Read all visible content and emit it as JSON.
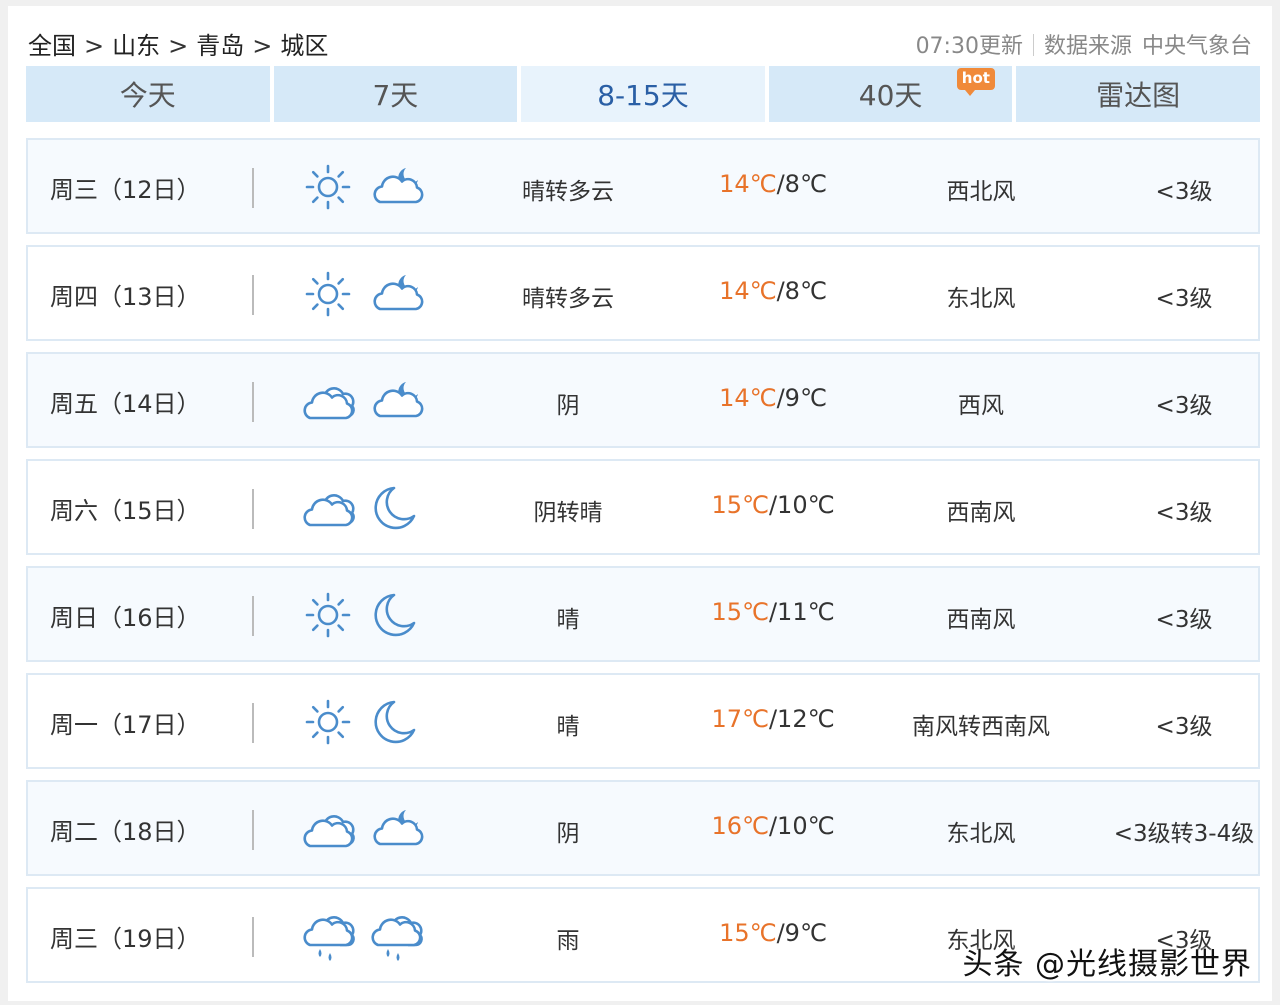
{
  "breadcrumb": [
    "全国",
    "山东",
    "青岛",
    "城区"
  ],
  "breadcrumb_separator": ">",
  "update": {
    "time_text": "07:30更新",
    "source_label": "数据来源",
    "source_name": "中央气象台"
  },
  "tabs": [
    {
      "label": "今天",
      "active": false
    },
    {
      "label": "7天",
      "active": false
    },
    {
      "label": "8-15天",
      "active": true
    },
    {
      "label": "40天",
      "active": false,
      "badge": "hot"
    },
    {
      "label": "雷达图",
      "active": false
    }
  ],
  "colors": {
    "accent": "#2a5fa5",
    "tab_bg": "#d6e9f8",
    "high_temp": "#e8732a",
    "icon": "#4a8ccb",
    "badge": "#f08a3a"
  },
  "forecast": [
    {
      "date": "周三（12日）",
      "day_icon": "sun-icon",
      "night_icon": "cloud-moon-icon",
      "condition": "晴转多云",
      "high": "14℃",
      "low": "8℃",
      "wind": "西北风",
      "level": "<3级"
    },
    {
      "date": "周四（13日）",
      "day_icon": "sun-icon",
      "night_icon": "cloud-moon-icon",
      "condition": "晴转多云",
      "high": "14℃",
      "low": "8℃",
      "wind": "东北风",
      "level": "<3级"
    },
    {
      "date": "周五（14日）",
      "day_icon": "overcast-icon",
      "night_icon": "cloud-moon-icon",
      "condition": "阴",
      "high": "14℃",
      "low": "9℃",
      "wind": "西风",
      "level": "<3级"
    },
    {
      "date": "周六（15日）",
      "day_icon": "overcast-icon",
      "night_icon": "moon-icon",
      "condition": "阴转晴",
      "high": "15℃",
      "low": "10℃",
      "wind": "西南风",
      "level": "<3级"
    },
    {
      "date": "周日（16日）",
      "day_icon": "sun-icon",
      "night_icon": "moon-icon",
      "condition": "晴",
      "high": "15℃",
      "low": "11℃",
      "wind": "西南风",
      "level": "<3级"
    },
    {
      "date": "周一（17日）",
      "day_icon": "sun-icon",
      "night_icon": "moon-icon",
      "condition": "晴",
      "high": "17℃",
      "low": "12℃",
      "wind": "南风转西南风",
      "level": "<3级"
    },
    {
      "date": "周二（18日）",
      "day_icon": "overcast-icon",
      "night_icon": "cloud-moon-icon",
      "condition": "阴",
      "high": "16℃",
      "low": "10℃",
      "wind": "东北风",
      "level": "<3级转3-4级"
    },
    {
      "date": "周三（19日）",
      "day_icon": "rain-icon",
      "night_icon": "rain-icon",
      "condition": "雨",
      "high": "15℃",
      "low": "9℃",
      "wind": "东北风",
      "level": "<3级"
    }
  ],
  "watermark": "头条 @光线摄影世界"
}
